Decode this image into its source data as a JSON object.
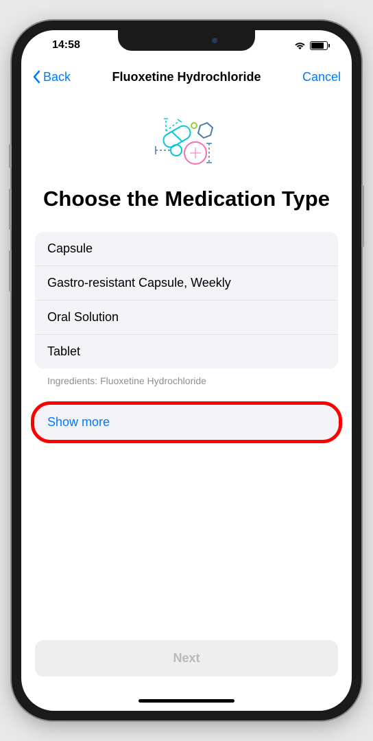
{
  "status_bar": {
    "time": "14:58"
  },
  "nav": {
    "back_label": "Back",
    "title": "Fluoxetine Hydrochloride",
    "cancel_label": "Cancel"
  },
  "page_title": "Choose the Medication Type",
  "options": [
    "Capsule",
    "Gastro-resistant Capsule, Weekly",
    "Oral Solution",
    "Tablet"
  ],
  "ingredients_label": "Ingredients:",
  "ingredients_value": "Fluoxetine Hydrochloride",
  "show_more_label": "Show more",
  "next_label": "Next",
  "colors": {
    "accent": "#007AFF",
    "highlight": "#ff0000"
  }
}
